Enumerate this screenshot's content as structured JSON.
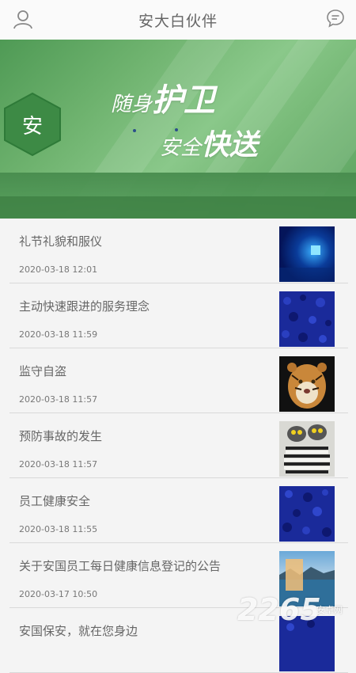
{
  "header": {
    "title": "安大白伙伴",
    "left_icon": "user-icon",
    "right_icon": "message-icon"
  },
  "banner": {
    "hex_char": "安",
    "slogan_line1_small": "随身",
    "slogan_line1_big": "护卫",
    "slogan_line2_small": "安全",
    "slogan_line2_big": "快送",
    "colors": {
      "green_dark": "#4f9a55",
      "green_light": "#8ac88a"
    }
  },
  "news": [
    {
      "headline": "礼节礼貌和服仪",
      "date": "2020-03-18 12:01",
      "thumb": "blue-light-square"
    },
    {
      "headline": "主动快速跟进的服务理念",
      "date": "2020-03-18 11:59",
      "thumb": "blue-texture"
    },
    {
      "headline": "监守自盗",
      "date": "2020-03-18 11:57",
      "thumb": "tiger"
    },
    {
      "headline": "预防事故的发生",
      "date": "2020-03-18 11:57",
      "thumb": "lemurs"
    },
    {
      "headline": "员工健康安全",
      "date": "2020-03-18 11:55",
      "thumb": "blue-texture"
    },
    {
      "headline": "关于安国员工每日健康信息登记的公告",
      "date": "2020-03-17 10:50",
      "thumb": "lake-landscape"
    },
    {
      "headline": "安国保安，就在您身边",
      "date": "",
      "thumb": "blue-texture"
    }
  ],
  "watermark": {
    "number": "2265",
    "sub": "安卓网"
  }
}
